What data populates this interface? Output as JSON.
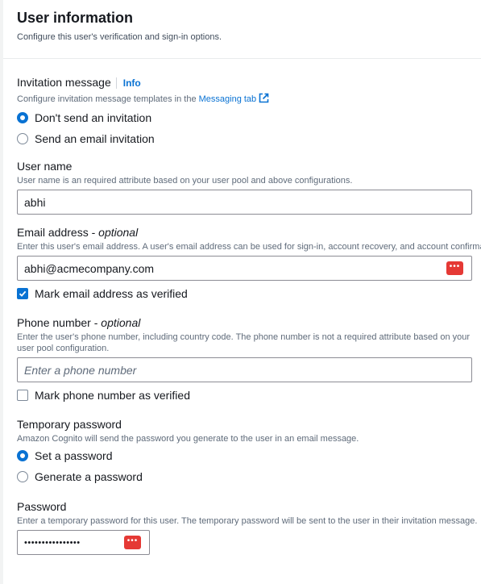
{
  "header": {
    "title": "User information",
    "subtitle": "Configure this user's verification and sign-in options."
  },
  "invitation": {
    "label": "Invitation message",
    "info": "Info",
    "desc_prefix": "Configure invitation message templates in the ",
    "desc_link": "Messaging tab",
    "options": [
      {
        "label": "Don't send an invitation",
        "checked": true
      },
      {
        "label": "Send an email invitation",
        "checked": false
      }
    ]
  },
  "username": {
    "label": "User name",
    "desc": "User name is an required attribute based on your user pool and above configurations.",
    "value": "abhi"
  },
  "email": {
    "label": "Email address",
    "optional": "optional",
    "desc": "Enter this user's email address. A user's email address can be used for sign-in, account recovery, and account confirmation.",
    "value": "abhi@acmecompany.com",
    "verify_label": "Mark email address as verified",
    "verified": true
  },
  "phone": {
    "label": "Phone number",
    "optional": "optional",
    "desc": "Enter the user's phone number, including country code. The phone number is not a required attribute based on your user pool configuration.",
    "placeholder": "Enter a phone number",
    "verify_label": "Mark phone number as verified",
    "verified": false
  },
  "temp_password": {
    "label": "Temporary password",
    "desc": "Amazon Cognito will send the password you generate to the user in an email message.",
    "options": [
      {
        "label": "Set a password",
        "checked": true
      },
      {
        "label": "Generate a password",
        "checked": false
      }
    ]
  },
  "password": {
    "label": "Password",
    "desc": "Enter a temporary password for this user. The temporary password will be sent to the user in their invitation message.",
    "value": "••••••••••••••••"
  },
  "colors": {
    "accent": "#0972d3",
    "password_manager": "#e53935"
  },
  "icons": {
    "external_link": "external-link-icon",
    "password_manager": "password-manager-icon",
    "checkmark": "checkmark-icon"
  }
}
